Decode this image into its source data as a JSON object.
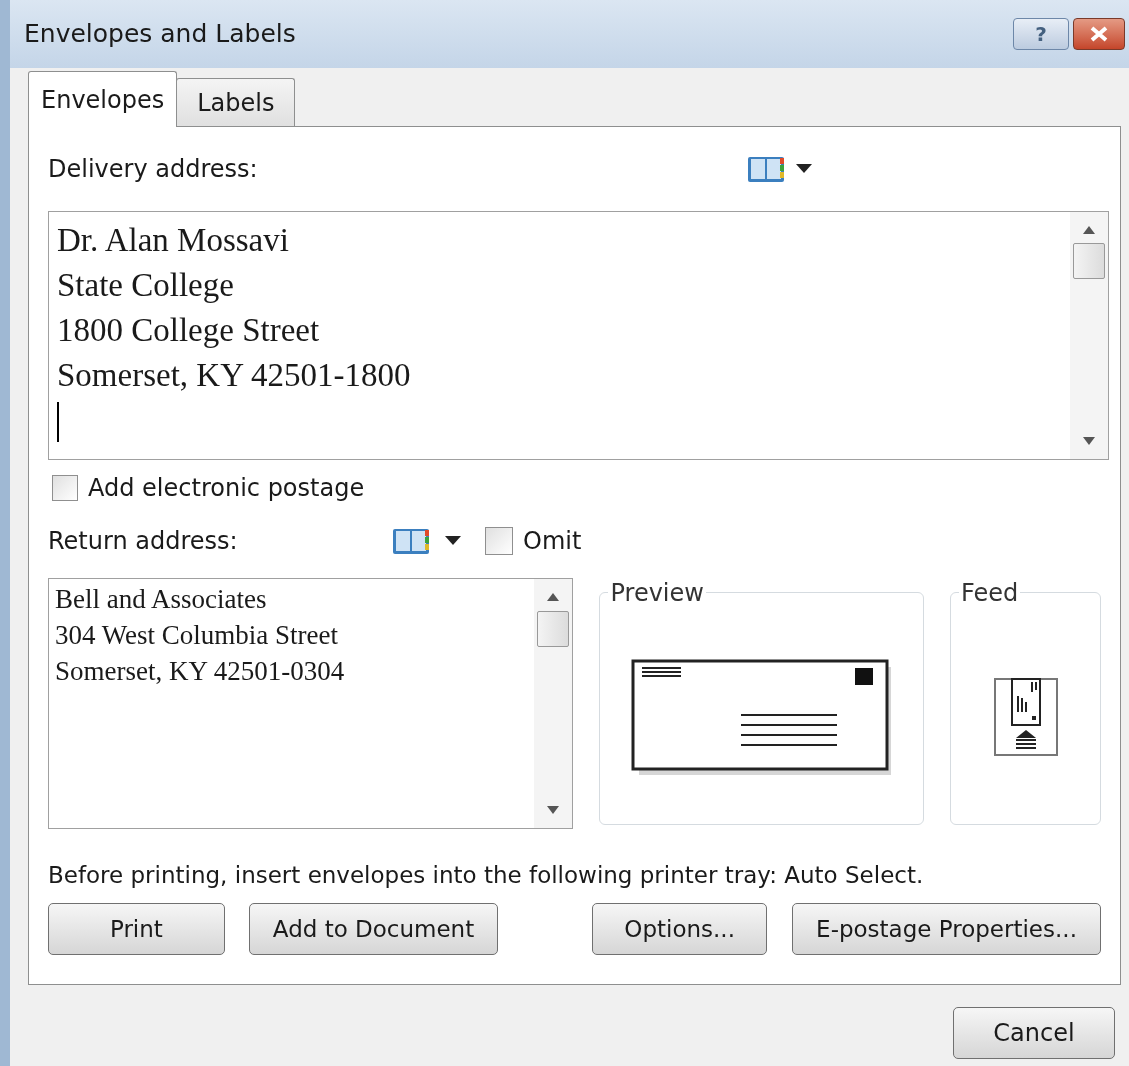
{
  "window": {
    "title": "Envelopes and Labels",
    "help_label": "?"
  },
  "tabs": [
    {
      "label": "Envelopes",
      "selected": true
    },
    {
      "label": "Labels",
      "selected": false
    }
  ],
  "delivery": {
    "label": "Delivery address:",
    "lines": [
      "Dr. Alan Mossavi",
      "State College",
      "1800 College Street",
      "Somerset, KY 42501-1800"
    ]
  },
  "electronic_postage": {
    "label": "Add electronic postage",
    "checked": false
  },
  "return_address": {
    "label": "Return address:",
    "omit": {
      "label": "Omit",
      "checked": false
    },
    "lines": [
      "Bell and Associates",
      "304 West Columbia Street",
      "Somerset, KY 42501-0304"
    ]
  },
  "preview": {
    "label": "Preview"
  },
  "feed": {
    "label": "Feed"
  },
  "note": "Before printing, insert envelopes into the following printer tray: Auto Select.",
  "buttons": [
    {
      "label": "Print"
    },
    {
      "label": "Add to Document"
    },
    {
      "label": "Options..."
    },
    {
      "label": "E-postage Properties..."
    }
  ],
  "cancel": "Cancel"
}
